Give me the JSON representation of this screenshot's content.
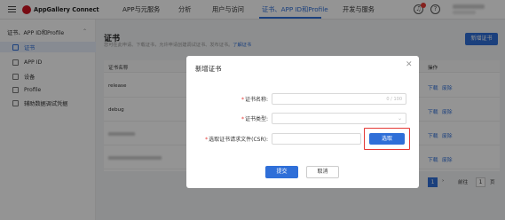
{
  "topbar": {
    "brand": "AppGallery Connect",
    "nav": [
      "APP与元服务",
      "分析",
      "用户与访问",
      "证书、APP ID和Profile",
      "开发与服务"
    ],
    "active_nav_index": 3
  },
  "sidebar": {
    "section": "证书、APP ID和Profile",
    "items": [
      {
        "label": "证书",
        "active": true
      },
      {
        "label": "APP ID",
        "active": false
      },
      {
        "label": "设备",
        "active": false
      },
      {
        "label": "Profile",
        "active": false
      },
      {
        "label": "辅助数据调试凭据",
        "active": false
      }
    ]
  },
  "main": {
    "title": "证书",
    "description": "您可在此申请、下载证书，允许申请创建调试证书、发布证书。",
    "learn_more": "了解证书",
    "new_cert_button": "新增证书",
    "table": {
      "header_name": "证书名称",
      "header_action": "操作",
      "rows": [
        {
          "name": "release",
          "download": "下载",
          "revoke": "废除"
        },
        {
          "name": "debug",
          "download": "下载",
          "revoke": "废除"
        },
        {
          "name": "",
          "download": "下载",
          "revoke": "废除"
        },
        {
          "name": "",
          "download": "下载",
          "revoke": "废除"
        }
      ]
    },
    "pager": {
      "current": "1",
      "goto_label": "前往",
      "goto_value": "1",
      "page_unit": "页"
    }
  },
  "dialog": {
    "title": "新增证书",
    "name_label": "证书名称:",
    "name_counter": "0 / 100",
    "type_label": "证书类型:",
    "csr_label": "选取证书请求文件(CSR):",
    "select_button": "选取",
    "submit_button": "提交",
    "cancel_button": "取消",
    "accent_color": "#2f6fd8",
    "highlight_color": "#e53935"
  }
}
